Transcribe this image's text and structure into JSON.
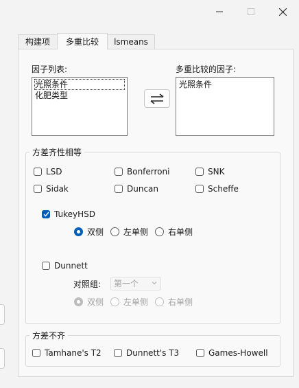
{
  "tabs": [
    {
      "label": "构建项",
      "active": false
    },
    {
      "label": "多重比较",
      "active": true
    },
    {
      "label": "lsmeans",
      "active": false
    }
  ],
  "factor_list": {
    "label": "因子列表:",
    "items": [
      "光照条件",
      "化肥类型"
    ]
  },
  "compare_factors": {
    "label": "多重比较的因子:",
    "items": [
      "光照条件"
    ]
  },
  "equal_variance": {
    "legend": "方差齐性相等",
    "options": [
      {
        "label": "LSD",
        "checked": false
      },
      {
        "label": "Bonferroni",
        "checked": false
      },
      {
        "label": "SNK",
        "checked": false
      },
      {
        "label": "Sidak",
        "checked": false
      },
      {
        "label": "Duncan",
        "checked": false
      },
      {
        "label": "Scheffe",
        "checked": false
      }
    ],
    "tukey": {
      "label": "TukeyHSD",
      "checked": true,
      "sides": [
        {
          "label": "双侧",
          "selected": true
        },
        {
          "label": "左单侧",
          "selected": false
        },
        {
          "label": "右单侧",
          "selected": false
        }
      ]
    },
    "dunnett": {
      "label": "Dunnett",
      "checked": false,
      "control_label": "对照组:",
      "control_value": "第一个",
      "sides": [
        {
          "label": "双侧",
          "selected": true
        },
        {
          "label": "左单侧",
          "selected": false
        },
        {
          "label": "右单侧",
          "selected": false
        }
      ]
    }
  },
  "unequal_variance": {
    "legend": "方差不齐",
    "options": [
      {
        "label": "Tamhane's T2",
        "checked": false
      },
      {
        "label": "Dunnett's T3",
        "checked": false
      },
      {
        "label": "Games-Howell",
        "checked": false
      }
    ]
  },
  "colors": {
    "accent": "#005fb8",
    "disabled_text": "#a3a3a3",
    "panel_bg": "#f9f9f9",
    "window_bg": "#f3f3f3"
  }
}
